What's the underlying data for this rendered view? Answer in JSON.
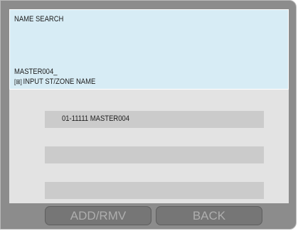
{
  "screen": {
    "title": "NAME SEARCH",
    "input_value": "MASTER004_",
    "hint_icon": "[⊞]",
    "hint_text": "INPUT ST/ZONE NAME"
  },
  "results": [
    {
      "text": "01-11111 MASTER004"
    },
    {
      "text": ""
    },
    {
      "text": ""
    },
    {
      "text": ""
    }
  ],
  "buttons": {
    "add_remove": "ADD/RMV",
    "back": "BACK"
  },
  "colors": {
    "accent_panel": "#d7ecf5",
    "device_body": "#8c8c8c",
    "list_bg": "#e3e3e3",
    "row_bg": "#cbcbcb",
    "button_bg": "#767676",
    "button_text": "#aeaeae",
    "leader_red": "#e0322d"
  }
}
